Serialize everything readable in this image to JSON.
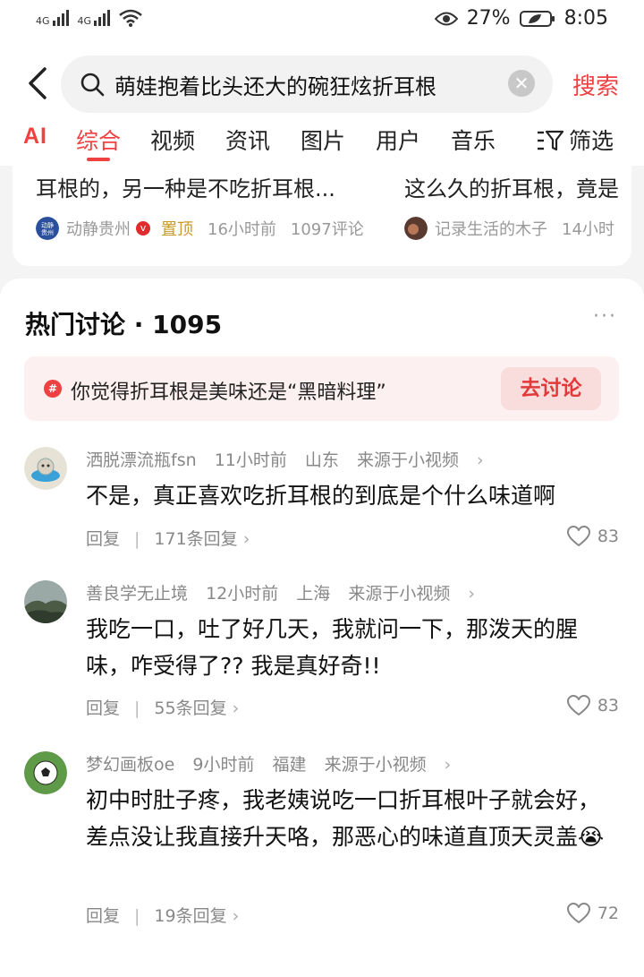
{
  "status_bar": {
    "battery": "27%",
    "time": "8:05",
    "signal_1": "4G",
    "signal_2": "4G"
  },
  "search": {
    "query": "萌娃抱着比头还大的碗狂炫折耳根",
    "button": "搜索"
  },
  "tabs": [
    {
      "label": "AI"
    },
    {
      "label": "综合"
    },
    {
      "label": "视频"
    },
    {
      "label": "资讯"
    },
    {
      "label": "图片"
    },
    {
      "label": "用户"
    },
    {
      "label": "音乐"
    },
    {
      "label": "筛选"
    }
  ],
  "top_results": [
    {
      "title": "耳根的，另一种是不吃折耳根...",
      "author": "动静贵州",
      "badge": "置顶",
      "time": "16小时前",
      "comments": "1097评论"
    },
    {
      "title": "这么久的折耳根，竟是",
      "author": "记录生活的木子",
      "time": "14小时"
    }
  ],
  "discussion": {
    "title": "热门讨论 · 1095",
    "topic": "你觉得折耳根是美味还是“黑暗料理”",
    "topic_button": "去讨论"
  },
  "comments": [
    {
      "user": "洒脱漂流瓶fsn",
      "time": "11小时前",
      "location": "山东",
      "source": "来源于小视频",
      "text": "不是，真正喜欢吃折耳根的到底是个什么味道啊",
      "reply_label": "回复",
      "reply_count": "171条回复",
      "likes": "83"
    },
    {
      "user": "善良学无止境",
      "time": "12小时前",
      "location": "上海",
      "source": "来源于小视频",
      "text": "我吃一口，吐了好几天，我就问一下，那泼天的腥味，咋受得了?? 我是真好奇!!",
      "reply_label": "回复",
      "reply_count": "55条回复",
      "likes": "83"
    },
    {
      "user": "梦幻画板oe",
      "time": "9小时前",
      "location": "福建",
      "source": "来源于小视频",
      "text": "初中时肚子疼，我老姨说吃一口折耳根叶子就会好，差点没让我直接升天咯，那恶心的味道直顶天灵盖😭",
      "reply_label": "回复",
      "reply_count": "19条回复",
      "likes": "72"
    }
  ],
  "colors": {
    "accent": "#f04142",
    "pinned": "#c99a2a",
    "topic_bg": "#fdf0f0"
  }
}
